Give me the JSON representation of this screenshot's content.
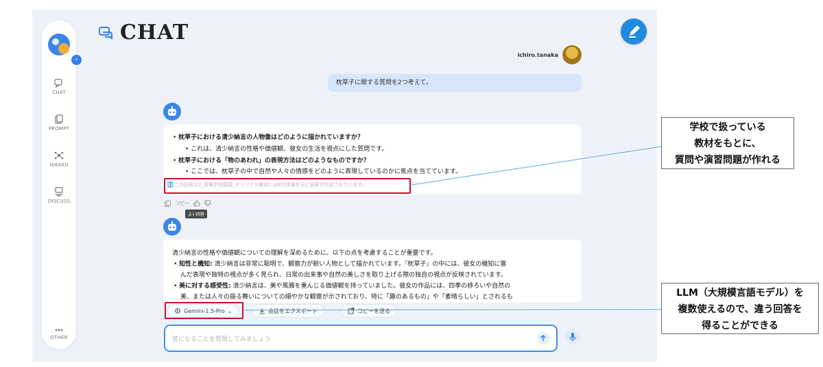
{
  "app": {
    "title": "CHAT",
    "accent": "#2f80ed"
  },
  "sidebar": {
    "items": [
      {
        "label": "CHAT",
        "icon": "chat-icon"
      },
      {
        "label": "PROMPT",
        "icon": "prompt-icon"
      },
      {
        "label": "HIKAKU",
        "icon": "compare-icon"
      },
      {
        "label": "DISCUSS",
        "icon": "discuss-icon"
      },
      {
        "label": "OTHER",
        "icon": "more-icon"
      }
    ]
  },
  "user": {
    "name": "ichiro.tanaka"
  },
  "messages": {
    "user_prompt": "枕草子に関する質問を2つ考えて。",
    "answer1": {
      "q1": "枕草子における清少納言の人物像はどのように描かれていますか？",
      "q1_note": "これは、清少納言の性格や価値観、彼女の生活を視点にした質問です。",
      "q2": "枕草子における「物のあわれ」の表現方法はどのようなものですか？",
      "q2_note": "ここでは、枕草子の中で自然や人々の情感をどのように表現しているのかに焦点を当てています。",
      "source": "この回答は2_高等学校国語_オリジナル教材1.pdfの情報を元に回答が生成されています。"
    },
    "feedback": {
      "copy_label": "コピー",
      "tooltip": "よい回答"
    },
    "answer2": {
      "intro": "清少納言の性格や価値観についての理解を深めるために、以下の点を考慮することが重要です。",
      "p1_title": "知性と機知:",
      "p1_text": "清少納言は非常に聡明で、観察力が鋭い人物として描かれています。『枕草子』の中には、彼女の機知に富",
      "p1_cont": "んだ表現や独特の視点が多く見られ、日常の出来事や自然の美しさを取り上げる際の独自の視点が反映されています。",
      "p2_title": "美に対する感受性:",
      "p2_text": "清少納言は、美や風雅を重んじる価値観を持っていました。彼女の作品には、四季の移ろいや自然の",
      "p2_cont": "美、または人々の振る舞いについての細やかな観察が示されており、特に「趣のあるもの」や「素晴らしい」とされるも"
    }
  },
  "toolbar": {
    "model": "Gemini-1.5-Pro",
    "export_label": "会話をエクスポート",
    "copy_send_label": "コピーを送る"
  },
  "input": {
    "placeholder": "気になることを質問してみましょう"
  },
  "annotations": {
    "callout1": [
      "学校で扱っている",
      "教材をもとに、",
      "質問や演習問題が作れる"
    ],
    "callout2": [
      "LLM（大規模言語モデル）を",
      "複数使えるので、違う回答を",
      "得ることができる"
    ],
    "highlight_color": "#c8102e"
  }
}
